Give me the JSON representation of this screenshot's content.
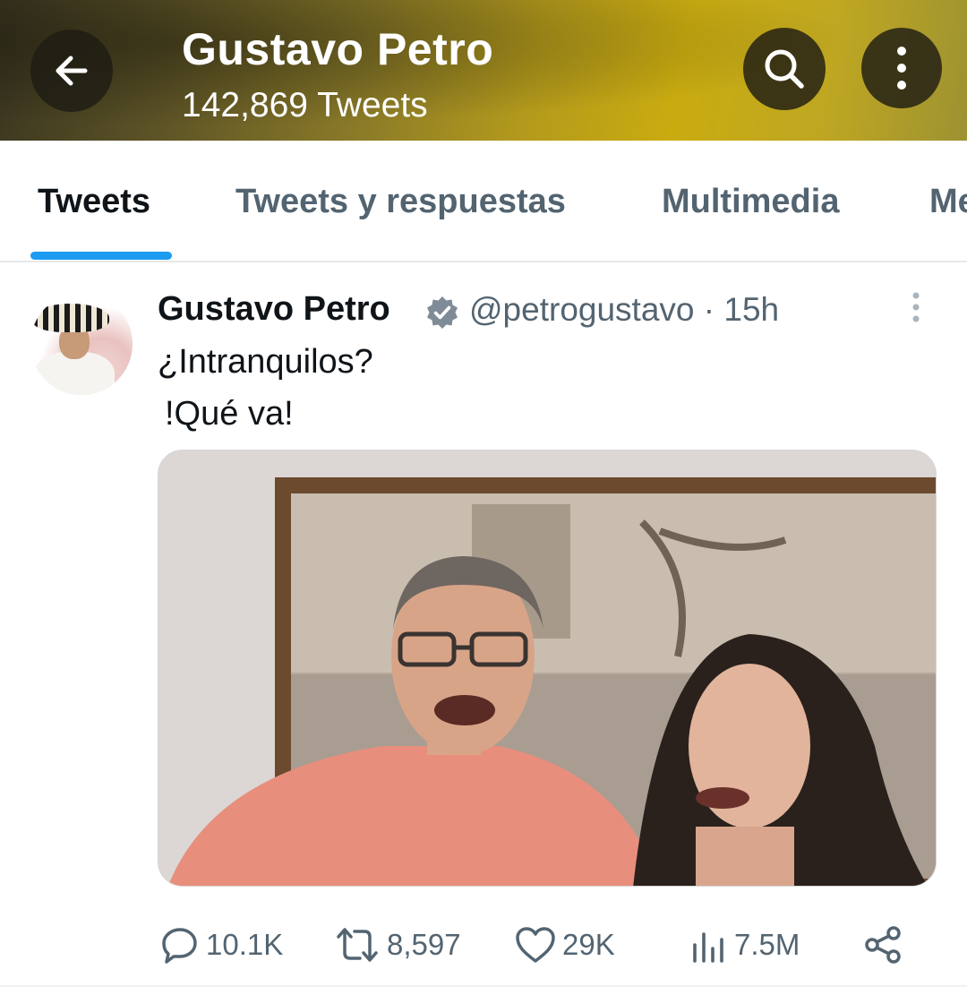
{
  "header": {
    "title": "Gustavo Petro",
    "subtitle": "142,869 Tweets"
  },
  "tabs": [
    {
      "label": "Tweets",
      "active": true
    },
    {
      "label": "Tweets y respuestas",
      "active": false
    },
    {
      "label": "Multimedia",
      "active": false
    },
    {
      "label": "Me",
      "active": false
    }
  ],
  "tweet": {
    "author_name": "Gustavo Petro",
    "handle_time": "@petrogustavo · 15h",
    "text_line1": "¿Intranquilos?",
    "text_line2": "!Qué va!",
    "stats": {
      "replies": "10.1K",
      "retweets": "8,597",
      "likes": "29K",
      "views": "7.5M"
    }
  },
  "colors": {
    "accent": "#1d9bf0",
    "header_gold": "#c9ab10",
    "muted_text": "#536471"
  },
  "icons": [
    "back-arrow-icon",
    "search-icon",
    "more-vertical-icon",
    "verified-badge-icon",
    "reply-icon",
    "retweet-icon",
    "like-icon",
    "views-icon",
    "share-icon"
  ]
}
